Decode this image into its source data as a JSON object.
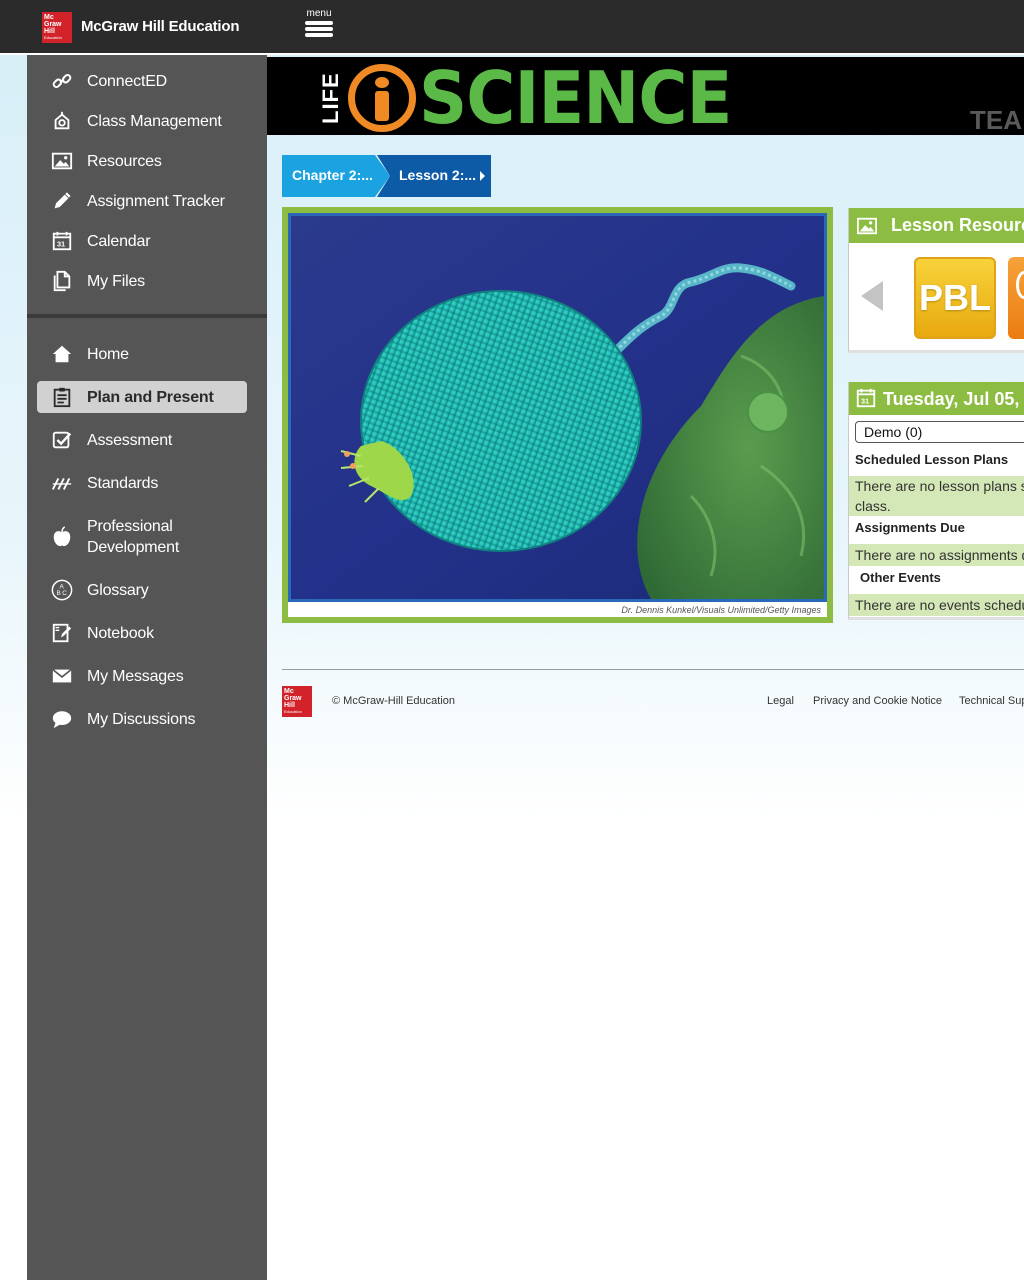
{
  "header": {
    "logo": {
      "lines": [
        "Mc",
        "Graw",
        "Hill",
        "Education"
      ]
    },
    "brand": "McGraw Hill Education",
    "menu_label": "menu"
  },
  "sidebar": {
    "top_items": [
      {
        "label": "ConnectED",
        "icon": "link-icon"
      },
      {
        "label": "Class Management",
        "icon": "apple-bell-icon"
      },
      {
        "label": "Resources",
        "icon": "image-icon"
      },
      {
        "label": "Assignment Tracker",
        "icon": "pencil-icon"
      },
      {
        "label": "Calendar",
        "icon": "calendar-icon"
      },
      {
        "label": "My Files",
        "icon": "files-icon"
      }
    ],
    "bottom_items": [
      {
        "label": "Home",
        "icon": "home-icon"
      },
      {
        "label": "Plan and Present",
        "icon": "clipboard-icon",
        "active": true
      },
      {
        "label": "Assessment",
        "icon": "checkbox-icon"
      },
      {
        "label": "Standards",
        "icon": "slashes-icon"
      },
      {
        "label": "Professional Development",
        "line1": "Professional",
        "line2": "Development",
        "icon": "apple-icon"
      },
      {
        "label": "Glossary",
        "icon": "abc-icon"
      },
      {
        "label": "Notebook",
        "icon": "notebook-icon"
      },
      {
        "label": "My Messages",
        "icon": "envelope-icon"
      },
      {
        "label": "My Discussions",
        "icon": "speech-bubble-icon"
      }
    ]
  },
  "banner": {
    "life": "LIFE",
    "science": "SCIENCE",
    "right_text": "TEA"
  },
  "breadcrumb": {
    "chapter": "Chapter 2:...",
    "lesson": "Lesson 2:..."
  },
  "hero": {
    "credit": "Dr. Dennis Kunkel/Visuals Unlimited/Getty Images"
  },
  "lesson_resources": {
    "title": "Lesson Resources",
    "tile_label": "PBL"
  },
  "calendar": {
    "date": "Tuesday, Jul 05,",
    "class_select": "Demo (0)",
    "scheduled_title": "Scheduled Lesson Plans",
    "scheduled_note_1": "There are no lesson plans s",
    "scheduled_note_2": "class.",
    "assignments_title": "Assignments Due",
    "assignments_note": "There are no assignments d",
    "events_title": "Other Events",
    "events_note": "There are no events schedu"
  },
  "footer": {
    "copyright": "© McGraw-Hill Education",
    "legal": "Legal",
    "privacy": "Privacy and Cookie Notice",
    "tech": "Technical Sup"
  },
  "colors": {
    "topbar": "#2b2b2b",
    "sidebar": "#555555",
    "active_item": "#d1d1d1",
    "accent_green": "#8cbd42",
    "science_green": "#5bb947",
    "i_orange": "#f08a24",
    "crumb_light": "#1ba2e1",
    "crumb_dark": "#0d5aa6",
    "brand_red": "#d2232a"
  }
}
